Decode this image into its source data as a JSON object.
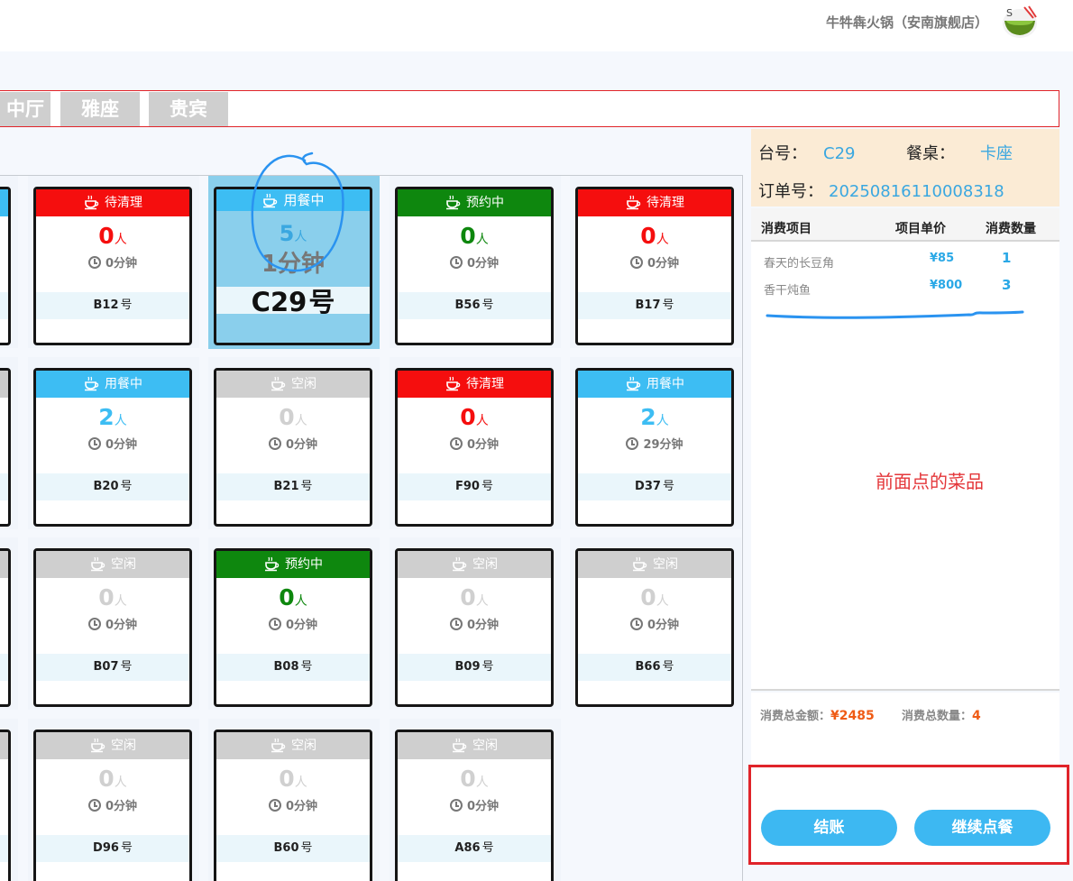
{
  "header": {
    "store_name": "牛牪犇火锅（安南旗舰店）",
    "logo_icon": "hotpot-bowl-icon"
  },
  "tabs": [
    {
      "label": "中厅"
    },
    {
      "label": "雅座"
    },
    {
      "label": "贵宾"
    }
  ],
  "colors": {
    "idle": "#cccccc",
    "dining": "#3dbdf3",
    "reserved": "#0e870e",
    "cleaning": "#f50e0e",
    "selected_bg": "#8acfec",
    "accent": "#3aa7e0"
  },
  "unit_people": "人",
  "unit_hao": "号",
  "tables": [
    {
      "name": "B12",
      "status": "待清理",
      "status_key": "cleaning",
      "count": "0",
      "time": "0分钟"
    },
    {
      "name": "C29",
      "status": "用餐中",
      "status_key": "dining",
      "count": "5",
      "time": "1分钟",
      "selected": true
    },
    {
      "name": "B56",
      "status": "预约中",
      "status_key": "reserved",
      "count": "0",
      "time": "0分钟"
    },
    {
      "name": "B17",
      "status": "待清理",
      "status_key": "cleaning",
      "count": "0",
      "time": "0分钟"
    },
    {
      "name": "B20",
      "status": "用餐中",
      "status_key": "dining",
      "count": "2",
      "time": "0分钟"
    },
    {
      "name": "B21",
      "status": "空闲",
      "status_key": "idle",
      "count": "0",
      "time": "0分钟"
    },
    {
      "name": "F90",
      "status": "待清理",
      "status_key": "cleaning",
      "count": "0",
      "time": "0分钟"
    },
    {
      "name": "D37",
      "status": "用餐中",
      "status_key": "dining",
      "count": "2",
      "time": "29分钟"
    },
    {
      "name": "B07",
      "status": "空闲",
      "status_key": "idle",
      "count": "0",
      "time": "0分钟"
    },
    {
      "name": "B08",
      "status": "预约中",
      "status_key": "reserved",
      "count": "0",
      "time": "0分钟"
    },
    {
      "name": "B09",
      "status": "空闲",
      "status_key": "idle",
      "count": "0",
      "time": "0分钟"
    },
    {
      "name": "B66",
      "status": "空闲",
      "status_key": "idle",
      "count": "0",
      "time": "0分钟"
    },
    {
      "name": "D96",
      "status": "空闲",
      "status_key": "idle",
      "count": "0",
      "time": "0分钟"
    },
    {
      "name": "B60",
      "status": "空闲",
      "status_key": "idle",
      "count": "0",
      "time": "0分钟"
    },
    {
      "name": "A86",
      "status": "空闲",
      "status_key": "idle",
      "count": "0",
      "time": "0分钟"
    }
  ],
  "panel": {
    "table_no_label": "台号：",
    "table_no": "C29",
    "table_type_label": "餐桌：",
    "table_type": "卡座",
    "order_no_label": "订单号：",
    "order_no": "20250816110008318",
    "col_item": "消费项目",
    "col_price": "项目单价",
    "col_qty": "消费数量",
    "items": [
      {
        "name": "春天的长豆角",
        "price": "¥85",
        "qty": "1"
      },
      {
        "name": "香干炖鱼",
        "price": "¥800",
        "qty": "3"
      }
    ],
    "annotation": "前面点的菜品",
    "total_amount_label": "消费总金额：",
    "total_amount": "¥2485",
    "total_qty_label": "消费总数量：",
    "total_qty": "4"
  },
  "buttons": {
    "checkout": "结账",
    "continue_order": "继续点餐"
  }
}
